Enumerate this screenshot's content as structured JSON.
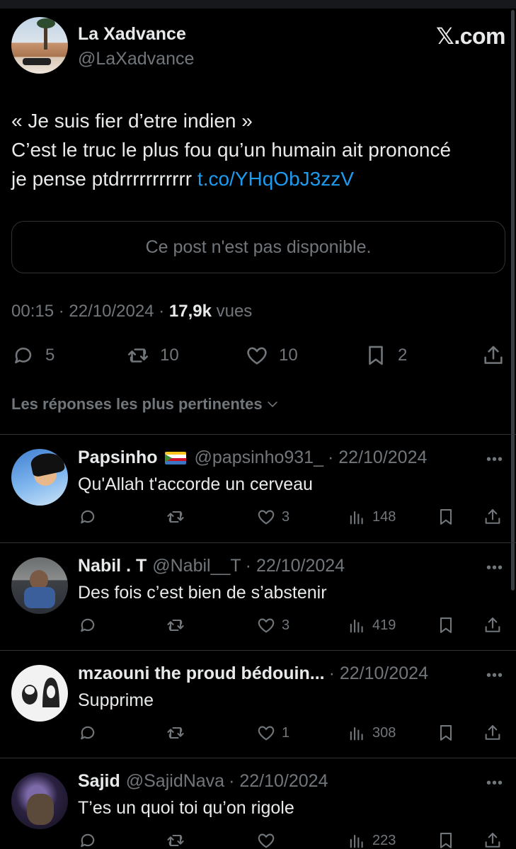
{
  "author": {
    "display_name": "La Xadvance",
    "handle": "@LaXadvance"
  },
  "brand": {
    "logo_text": ".com",
    "logo_glyph": "𝕏"
  },
  "tweet": {
    "lines": [
      "« Je suis fier d’etre indien »",
      "C’est le truc le plus fou qu’un humain ait prononcé",
      "je pense ptdrrrrrrrrrrr "
    ],
    "link": "t.co/YHqObJ3zzV",
    "quote_unavailable": "Ce post n'est pas disponible.",
    "time": "00:15",
    "date": "22/10/2024",
    "views_count": "17,9k",
    "views_label": "vues",
    "separator": "·"
  },
  "actions": {
    "replies": "5",
    "reposts": "10",
    "likes": "10",
    "bookmarks": "2"
  },
  "sort_label": "Les réponses les plus pertinentes",
  "replies": [
    {
      "name": "Papsinho",
      "handle": "@papsinho931_",
      "date": "· 22/10/2024",
      "text": "Qu'Allah t'accorde un cerveau",
      "likes": "3",
      "views": "148",
      "has_flag": true
    },
    {
      "name": "Nabil . T",
      "handle": "@Nabil__T",
      "date": "· 22/10/2024",
      "text": "Des fois c’est bien de s’abstenir",
      "likes": "3",
      "views": "419",
      "has_flag": false
    },
    {
      "name": "mzaouni the proud bédouin...",
      "handle": "",
      "date": "· 22/10/2024",
      "text": "Supprime",
      "likes": "1",
      "views": "308",
      "has_flag": false
    },
    {
      "name": "Sajid",
      "handle": "@SajidNava",
      "date": "· 22/10/2024",
      "text": "T’es un quoi toi qu’on rigole",
      "likes": "",
      "views": "223",
      "has_flag": false
    }
  ],
  "more_glyph": "•••",
  "colors": {
    "background": "#000000",
    "text": "#e7e9ea",
    "muted": "#71767b",
    "link": "#1d9bf0",
    "border": "#2f3336"
  }
}
